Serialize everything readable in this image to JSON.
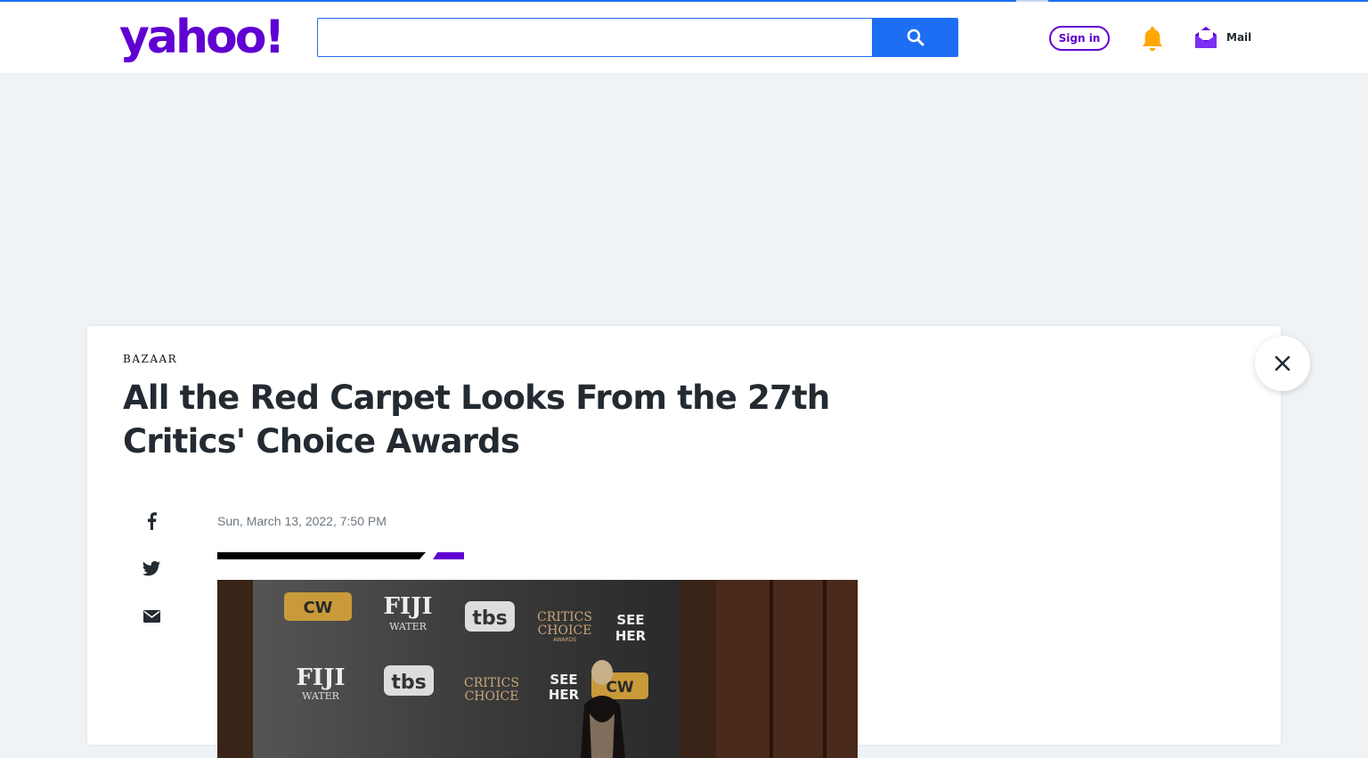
{
  "header": {
    "logo_text": "yahoo!",
    "search": {
      "value": "",
      "placeholder": ""
    },
    "signin_label": "Sign in",
    "mail_label": "Mail"
  },
  "article": {
    "publisher": "BAZAAR",
    "title": "All the Red Carpet Looks From the 27th Critics' Choice Awards",
    "date": "Sun, March 13, 2022, 7:50 PM",
    "share_icons": [
      "facebook-icon",
      "twitter-icon",
      "email-icon"
    ]
  },
  "photo": {
    "wall_text": {
      "cw": "CW",
      "fiji": "FIJI",
      "water": "WATER",
      "tbs": "tbs",
      "critics": "CRITICS",
      "choice": "CHOICE",
      "awards": "AWARDS",
      "see": "SEE",
      "her": "HER"
    }
  },
  "colors": {
    "brand": "#6001d2",
    "accent": "#1d6ef2",
    "page_bg": "#f0f3f5",
    "text": "#232a31"
  }
}
